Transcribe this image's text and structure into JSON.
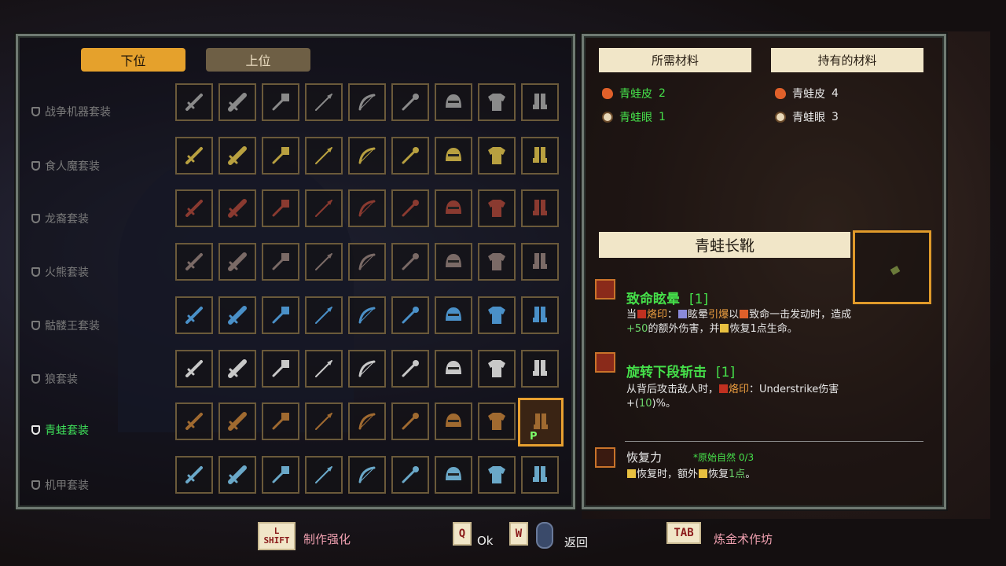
{
  "tabs": {
    "lower": "下位",
    "upper": "上位"
  },
  "sets": [
    {
      "label": "战争机器套装",
      "active": false
    },
    {
      "label": "食人魔套装",
      "active": false
    },
    {
      "label": "龙裔套装",
      "active": false
    },
    {
      "label": "火熊套装",
      "active": false
    },
    {
      "label": "骷髅王套装",
      "active": false
    },
    {
      "label": "狼套装",
      "active": false
    },
    {
      "label": "青蛙套装",
      "active": true
    },
    {
      "label": "机甲套装",
      "active": false
    }
  ],
  "grid_slots": [
    "sword",
    "greatsword",
    "axe",
    "spear",
    "bow",
    "staff",
    "helmet",
    "armor",
    "boots"
  ],
  "set_colors": [
    "#8a8a8a",
    "#b8a040",
    "#8a3a30",
    "#7a6a66",
    "#4a90c8",
    "#c8c8c8",
    "#a06a30",
    "#6aa8c8"
  ],
  "materials": {
    "required_header": "所需材料",
    "owned_header": "持有的材料",
    "required": [
      {
        "name": "青蛙皮",
        "count": "2"
      },
      {
        "name": "青蛙眼",
        "count": "1"
      }
    ],
    "owned": [
      {
        "name": "青蛙皮",
        "count": "4"
      },
      {
        "name": "青蛙眼",
        "count": "3"
      }
    ]
  },
  "item": {
    "name": "青蛙长靴"
  },
  "skills": [
    {
      "title": "致命眩晕",
      "level": "[1]",
      "desc_parts": [
        "当",
        "烙印",
        "：",
        "眩晕",
        "引爆",
        "以",
        "致命一击",
        "发动时，造成",
        "+50",
        "的额外伤害，并",
        "恢复1点生命。"
      ]
    },
    {
      "title": "旋转下段斩击",
      "level": "[1]",
      "desc_parts": [
        "从背后攻击敌人时，",
        "烙印",
        "：Understrike伤害",
        "+(",
        "10",
        ")%。"
      ]
    },
    {
      "title": "恢复力",
      "sub": "*原始自然 0/3",
      "desc_parts": [
        "恢复时，额外",
        "恢复",
        "1点",
        "。"
      ]
    }
  ],
  "footer": {
    "lshift_key": "L SHIFT",
    "lshift_label": "制作强化",
    "q_key": "Q",
    "q_label": "Ok",
    "w_key": "W",
    "back_label": "返回",
    "tab_key": "TAB",
    "tab_label": "炼金术作坊"
  }
}
